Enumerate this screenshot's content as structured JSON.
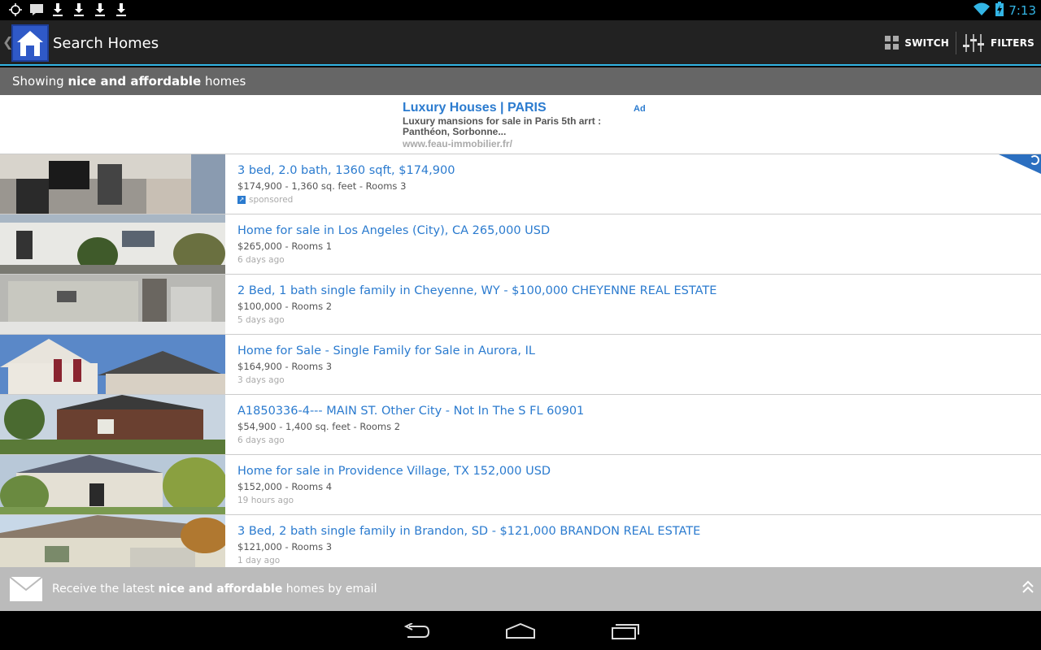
{
  "status_bar": {
    "time": "7:13"
  },
  "action_bar": {
    "title": "Search Homes",
    "switch_label": "SWITCH",
    "filters_label": "FILTERS"
  },
  "subtitle": {
    "prefix": "Showing",
    "query": "nice and affordable",
    "suffix": "homes"
  },
  "ad": {
    "title": "Luxury Houses | PARIS",
    "badge": "Ad",
    "description": "Luxury mansions for sale in Paris 5th arrt : Panthéon, Sorbonne...",
    "url": "www.feau-immobilier.fr/"
  },
  "listings": [
    {
      "title": "3 bed, 2.0 bath, 1360 sqft, $174,900",
      "details": "$174,900 - 1,360 sq. feet - Rooms 3",
      "meta": "sponsored"
    },
    {
      "title": "Home for sale in Los Angeles (City), CA 265,000 USD",
      "details": "$265,000 - Rooms 1",
      "meta": "6 days ago"
    },
    {
      "title": "2 Bed, 1 bath single family in Cheyenne, WY - $100,000 CHEYENNE REAL ESTATE",
      "details": "$100,000 - Rooms 2",
      "meta": "5 days ago"
    },
    {
      "title": "Home for Sale - Single Family for Sale in Aurora, IL",
      "details": "$164,900 - Rooms 3",
      "meta": "3 days ago"
    },
    {
      "title": "A1850336-4--- MAIN ST. Other City - Not In The S FL 60901",
      "details": "$54,900 - 1,400 sq. feet - Rooms 2",
      "meta": "6 days ago"
    },
    {
      "title": "Home for sale in Providence Village, TX 152,000 USD",
      "details": "$152,000 - Rooms 4",
      "meta": "19 hours ago"
    },
    {
      "title": "3 Bed, 2 bath single family in Brandon, SD - $121,000 BRANDON REAL ESTATE",
      "details": "$121,000 - Rooms 3",
      "meta": "1 day ago"
    }
  ],
  "email_bar": {
    "prefix": "Receive the latest",
    "query": "nice and affordable",
    "suffix": "homes by email"
  },
  "colors": {
    "accent": "#33b5e5",
    "link": "#2b7bcf",
    "actionbar": "#222222",
    "subbar": "#666666"
  }
}
